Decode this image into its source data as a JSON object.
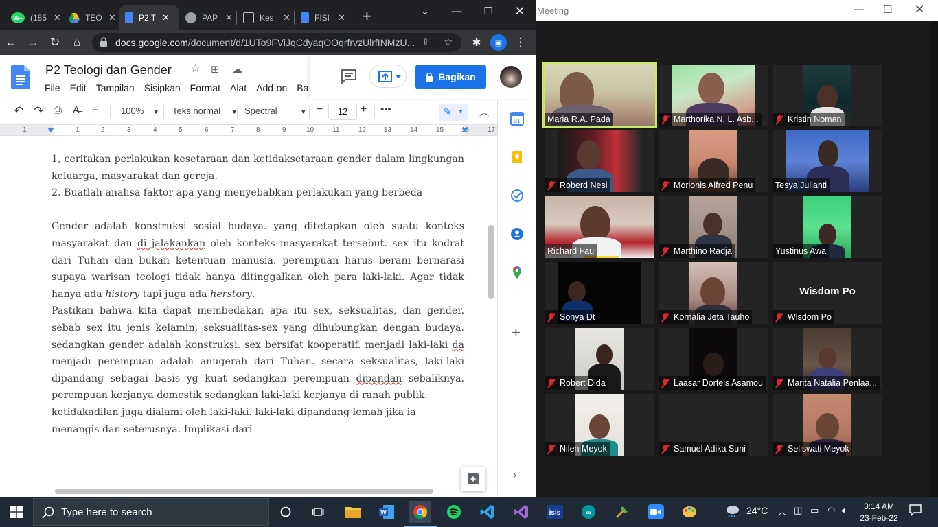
{
  "chrome": {
    "tabs": [
      {
        "title": "(185",
        "favicon": "whatsapp-icon",
        "color": "#25d366",
        "badge": "99+"
      },
      {
        "title": "TEO",
        "favicon": "drive-icon",
        "color": "#fbbc04"
      },
      {
        "title": "P2 T",
        "favicon": "docs-icon",
        "color": "#4285f4"
      },
      {
        "title": "PAP",
        "favicon": "globe-icon",
        "color": "#9aa0a6"
      },
      {
        "title": "Kes",
        "favicon": "chat-icon",
        "color": "#9aa0a6"
      },
      {
        "title": "FISI",
        "favicon": "docs-icon",
        "color": "#4285f4"
      }
    ],
    "new_tab": "+",
    "url_domain": "docs.google.com",
    "url_path": "/document/d/1UTo9FViJqCdyaqOOqrfrvzUlrfINMzU..."
  },
  "docs": {
    "title": "P2 Teologi dan Gender",
    "menu": [
      "File",
      "Edit",
      "Tampilan",
      "Sisipkan",
      "Format",
      "Alat",
      "Add-on",
      "Ba"
    ],
    "share_label": "Bagikan",
    "zoom": "100%",
    "style": "Teks normal",
    "font": "Spectral",
    "font_size": "12",
    "ruler_numbers": [
      "1",
      "1",
      "2",
      "3",
      "4",
      "5",
      "6",
      "7",
      "8",
      "9",
      "10",
      "11",
      "12",
      "13",
      "14",
      "15",
      "16",
      "17"
    ],
    "paragraphs": [
      "1, ceritakan perlakukan kesetaraan dan ketidaksetaraan gender dalam lingkungan keluarga, masyarakat dan gereja.",
      "2. Buatlah analisa faktor apa yang menyebabkan perlakukan yang berbeda",
      "",
      "Gender adalah konstruksi sosial budaya. yang ditetapkan oleh suatu konteks masyarakat dan ",
      "di jalakankan",
      " oleh konteks masyarakat tersebut. sex itu kodrat dari Tuhan dan bukan ketentuan manusia. perempuan harus berani bernarasi supaya warisan teologi tidak hanya ditinggalkan oleh para laki-laki. Agar tidak hanya ada ",
      "history",
      " tapi juga ada ",
      "herstory",
      ".",
      "Pastikan bahwa kita dapat membedakan apa itu sex, seksualitas, dan gender. sebab sex itu jenis kelamin, seksualitas-sex yang dihubungkan dengan budaya. sedangkan gender adalah konstruksi. sex bersifat kooperatif. menjadi laki-laki ",
      "da",
      " menjadi perempuan adalah anugerah dari Tuhan. secara seksualitas, laki-laki dipandang sebagai basis yg kuat sedangkan perempuan ",
      "dipandan",
      " sebaliknya. perempuan kerjanya domestik sedangkan laki-laki kerjanya di ranah publik.",
      "ketidakadilan juga dialami oleh laki-laki. laki-laki dipandang lemah jika ia menangis dan seterusnya. Implikasi dari"
    ]
  },
  "meeting": {
    "title": "Meeting",
    "participants": [
      {
        "name": "Maria R.A. Pada",
        "muted": false,
        "speaking": true
      },
      {
        "name": "Marthorika N. L. Asb...",
        "muted": true
      },
      {
        "name": "Kristin Noman",
        "muted": true
      },
      {
        "name": "Roberd Nesi",
        "muted": true
      },
      {
        "name": "Morionis Alfred Penu",
        "muted": true
      },
      {
        "name": "Tesya Julianti",
        "muted": false
      },
      {
        "name": "Richard Fau",
        "muted": false
      },
      {
        "name": "Marthino Radja",
        "muted": true
      },
      {
        "name": "Yustinus Awa",
        "muted": false
      },
      {
        "name": "Sonya Dt",
        "muted": true
      },
      {
        "name": "Kornalia Jeta Tauho",
        "muted": true
      },
      {
        "name": "Wisdom Po",
        "muted": true,
        "no_video_label": "Wisdom Po"
      },
      {
        "name": "Robert Dida",
        "muted": true
      },
      {
        "name": "Laasar Dorteis Asamou",
        "muted": true
      },
      {
        "name": "Marita Natalia Penlaa...",
        "muted": true
      },
      {
        "name": "Nilen Meyok",
        "muted": true
      },
      {
        "name": "Samuel Adika Suni",
        "muted": true
      },
      {
        "name": "Seliswati Meyok",
        "muted": true
      }
    ]
  },
  "taskbar": {
    "search_placeholder": "Type here to search",
    "temperature": "24°C",
    "time": "3:14 AM",
    "date": "23-Feb-22"
  }
}
